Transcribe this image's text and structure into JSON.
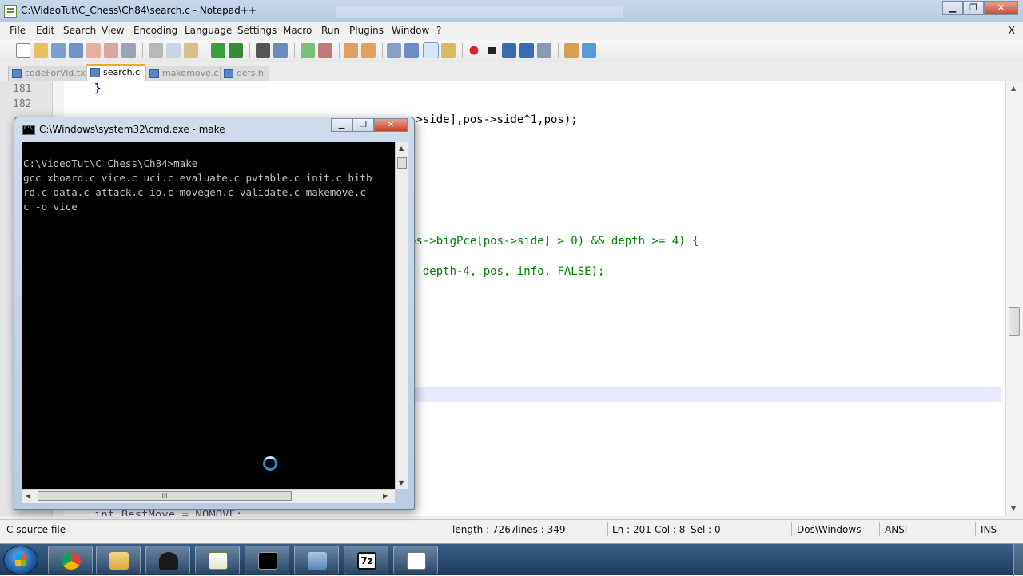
{
  "window": {
    "title": "C:\\VideoTut\\C_Chess\\Ch84\\search.c - Notepad++",
    "minimize": "▁",
    "restore": "❐",
    "close": "✕"
  },
  "menu": {
    "items": [
      "File",
      "Edit",
      "Search",
      "View",
      "Encoding",
      "Language",
      "Settings",
      "Macro",
      "Run",
      "Plugins",
      "Window",
      "?"
    ],
    "close": "X"
  },
  "tabs": [
    {
      "label": "codeForVld.txt",
      "active": false
    },
    {
      "label": "search.c",
      "active": true
    },
    {
      "label": "makemove.c",
      "active": false
    },
    {
      "label": "defs.h",
      "active": false
    }
  ],
  "editor": {
    "line_numbers": [
      "181",
      "182"
    ],
    "lines": [
      {
        "text": "}",
        "color": "#000080"
      },
      {
        "text": "->side],pos->side^1,pos);",
        "color": "#000000"
      },
      {
        "text": "os->bigPce[pos->side] > 0) && depth >= 4) {",
        "color": "#008000"
      },
      {
        "text": ", depth-4, pos, info, FALSE);",
        "color": "#008000"
      },
      {
        "text": "int BestMove = NOMOVE;",
        "color": "#555577"
      }
    ]
  },
  "status": {
    "filetype": "C source file",
    "length": "length : 7267",
    "lines": "lines : 349",
    "ln": "Ln : 201",
    "col": "Col : 8",
    "sel": "Sel : 0",
    "eol": "Dos\\Windows",
    "encoding": "ANSI",
    "mode": "INS"
  },
  "cmd": {
    "title": "C:\\Windows\\system32\\cmd.exe - make",
    "output": [
      "C:\\VideoTut\\C_Chess\\Ch84>make",
      "gcc xboard.c vice.c uci.c evaluate.c pvtable.c init.c bitb",
      "rd.c data.c attack.c io.c movegen.c validate.c makemove.c",
      "c -o vice"
    ],
    "scroll_grip": "III"
  },
  "taskbar": {
    "apps": [
      "chrome-icon",
      "file-explorer-icon",
      "chess-icon",
      "notepad-plus-plus-icon",
      "cmd-icon",
      "network-icon",
      "7zip-icon",
      "document-icon"
    ],
    "seven_zip_label": "7z"
  },
  "colors": {
    "accent_tab": "#f5a623",
    "caret_line": "#e8e8ff",
    "code_green": "#008000"
  }
}
